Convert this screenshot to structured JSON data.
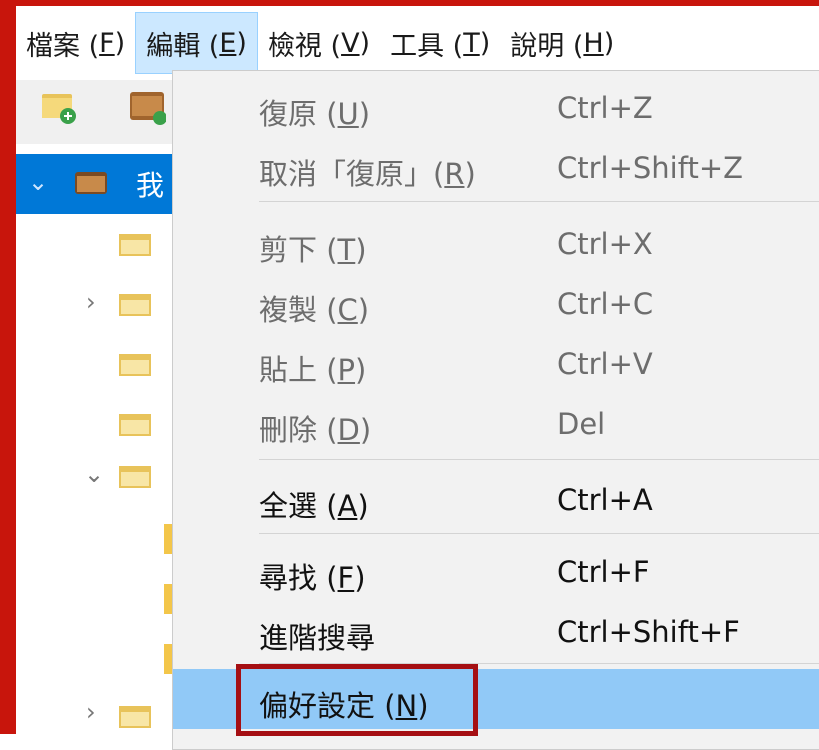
{
  "menubar": {
    "items": [
      {
        "text": "檔案 (",
        "mn": "F",
        "end": ")"
      },
      {
        "text": "編輯 (",
        "mn": "E",
        "end": ")"
      },
      {
        "text": "檢視 (",
        "mn": "V",
        "end": ")"
      },
      {
        "text": "工具 (",
        "mn": "T",
        "end": ")"
      },
      {
        "text": "說明 (",
        "mn": "H",
        "end": ")"
      }
    ]
  },
  "tree": {
    "root_label": "我"
  },
  "edit_menu": {
    "items": [
      {
        "text": "復原 (",
        "mn": "U",
        "end": ")",
        "shortcut": "Ctrl+Z"
      },
      {
        "text": "取消「復原」(",
        "mn": "R",
        "end": ")",
        "shortcut": "Ctrl+Shift+Z"
      },
      {
        "text": "剪下 (",
        "mn": "T",
        "end": ")",
        "shortcut": "Ctrl+X"
      },
      {
        "text": "複製 (",
        "mn": "C",
        "end": ")",
        "shortcut": "Ctrl+C"
      },
      {
        "text": "貼上 (",
        "mn": "P",
        "end": ")",
        "shortcut": "Ctrl+V"
      },
      {
        "text": "刪除 (",
        "mn": "D",
        "end": ")",
        "shortcut": "Del"
      },
      {
        "text": "全選 (",
        "mn": "A",
        "end": ")",
        "shortcut": "Ctrl+A"
      },
      {
        "text": "尋找 (",
        "mn": "F",
        "end": ")",
        "shortcut": "Ctrl+F"
      },
      {
        "text": "進階搜尋",
        "mn": "",
        "end": "",
        "shortcut": "Ctrl+Shift+F"
      },
      {
        "text": "偏好設定 (",
        "mn": "N",
        "end": ")",
        "shortcut": ""
      }
    ]
  },
  "colors": {
    "frame": "#c8150c",
    "selection": "#0078d7",
    "menu_highlight": "#91c9f7",
    "callout": "#a50f13"
  }
}
